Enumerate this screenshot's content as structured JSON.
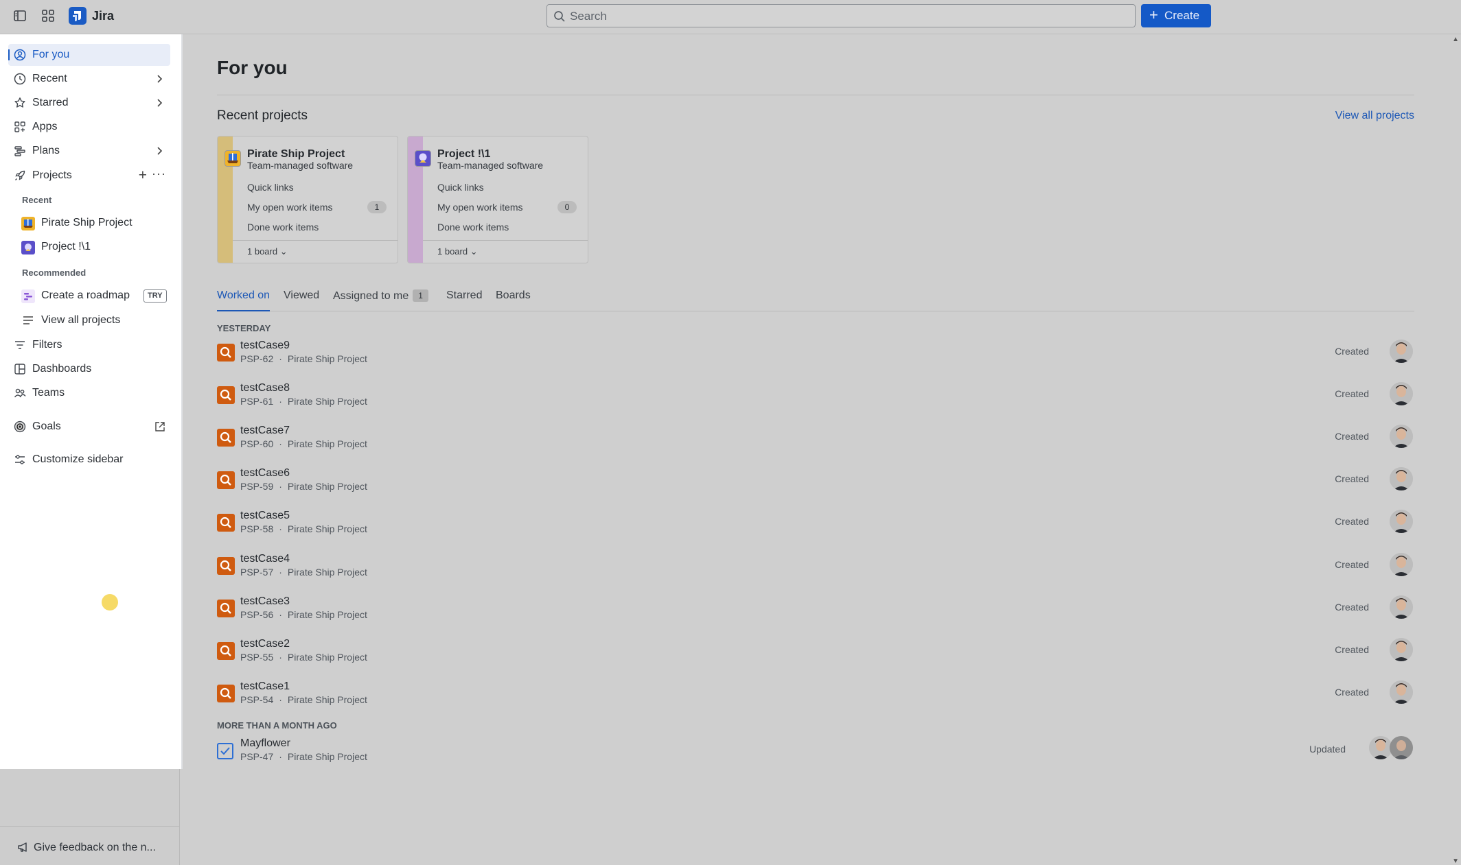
{
  "topbar": {
    "app_name": "Jira",
    "search_placeholder": "Search",
    "create_label": "Create"
  },
  "sidebar": {
    "for_you": "For you",
    "recent": "Recent",
    "starred": "Starred",
    "apps": "Apps",
    "plans": "Plans",
    "projects": "Projects",
    "recent_head": "Recent",
    "recent_projects": [
      "Pirate Ship Project",
      "Project !\\1"
    ],
    "recommended_head": "Recommended",
    "create_roadmap": "Create a roadmap",
    "try_badge": "TRY",
    "view_all_projects": "View all projects",
    "filters": "Filters",
    "dashboards": "Dashboards",
    "teams": "Teams",
    "goals": "Goals",
    "customize": "Customize sidebar",
    "feedback": "Give feedback on the n..."
  },
  "main": {
    "title": "For you",
    "recent_projects_title": "Recent projects",
    "view_all_projects": "View all projects",
    "cards": [
      {
        "name": "Pirate Ship Project",
        "type": "Team-managed software",
        "quick_links": "Quick links",
        "open_items_label": "My open work items",
        "open_items_count": "1",
        "done_label": "Done work items",
        "boards": "1 board",
        "stripe_color": "#d5bd7a"
      },
      {
        "name": "Project !\\1",
        "type": "Team-managed software",
        "quick_links": "Quick links",
        "open_items_label": "My open work items",
        "open_items_count": "0",
        "done_label": "Done work items",
        "boards": "1 board",
        "stripe_color": "#c8a9cf"
      }
    ],
    "tabs": {
      "worked_on": "Worked on",
      "viewed": "Viewed",
      "assigned": "Assigned to me",
      "assigned_count": "1",
      "starred": "Starred",
      "boards": "Boards"
    },
    "group_yesterday": "YESTERDAY",
    "group_older": "MORE THAN A MONTH AGO",
    "items": [
      {
        "title": "testCase9",
        "key": "PSP-62",
        "project": "Pirate Ship Project",
        "status": "Created"
      },
      {
        "title": "testCase8",
        "key": "PSP-61",
        "project": "Pirate Ship Project",
        "status": "Created"
      },
      {
        "title": "testCase7",
        "key": "PSP-60",
        "project": "Pirate Ship Project",
        "status": "Created"
      },
      {
        "title": "testCase6",
        "key": "PSP-59",
        "project": "Pirate Ship Project",
        "status": "Created"
      },
      {
        "title": "testCase5",
        "key": "PSP-58",
        "project": "Pirate Ship Project",
        "status": "Created"
      },
      {
        "title": "testCase4",
        "key": "PSP-57",
        "project": "Pirate Ship Project",
        "status": "Created"
      },
      {
        "title": "testCase3",
        "key": "PSP-56",
        "project": "Pirate Ship Project",
        "status": "Created"
      },
      {
        "title": "testCase2",
        "key": "PSP-55",
        "project": "Pirate Ship Project",
        "status": "Created"
      },
      {
        "title": "testCase1",
        "key": "PSP-54",
        "project": "Pirate Ship Project",
        "status": "Created"
      }
    ],
    "older_item": {
      "title": "Mayflower",
      "key": "PSP-47",
      "project": "Pirate Ship Project",
      "status": "Updated"
    }
  },
  "colors": {
    "accent": "#1459c7",
    "bug_icon": "#cf5b10",
    "task_icon": "#2d6fd4"
  }
}
